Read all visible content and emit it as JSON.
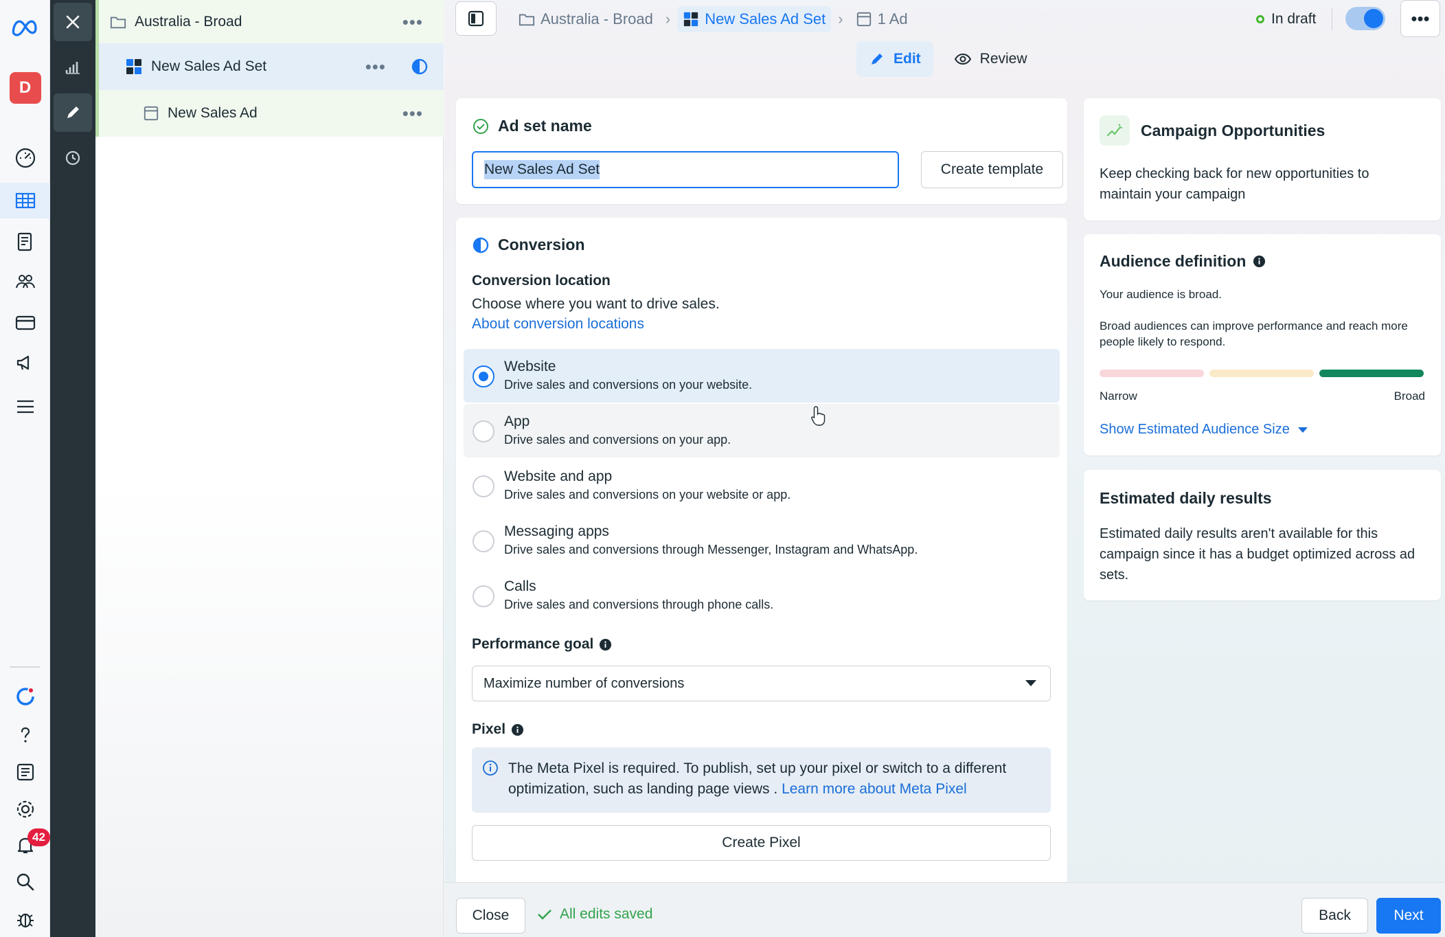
{
  "rail": {
    "avatar_letter": "D",
    "notification_count": "42"
  },
  "tree": {
    "campaign": "Australia - Broad",
    "adset": "New Sales Ad Set",
    "ad": "New Sales Ad",
    "more": "•••"
  },
  "breadcrumb": {
    "campaign": "Australia - Broad",
    "adset": "New Sales Ad Set",
    "ads": "1 Ad"
  },
  "status": {
    "label": "In draft",
    "toggle_on": true
  },
  "modes": {
    "edit": "Edit",
    "review": "Review"
  },
  "adset_name": {
    "title": "Ad set name",
    "value": "New Sales Ad Set",
    "template_button": "Create template"
  },
  "conversion": {
    "title": "Conversion",
    "location_heading": "Conversion location",
    "location_desc": "Choose where you want to drive sales.",
    "location_link": "About conversion locations",
    "options": [
      {
        "label": "Website",
        "desc": "Drive sales and conversions on your website.",
        "selected": true
      },
      {
        "label": "App",
        "desc": "Drive sales and conversions on your app.",
        "selected": false
      },
      {
        "label": "Website and app",
        "desc": "Drive sales and conversions on your website or app.",
        "selected": false
      },
      {
        "label": "Messaging apps",
        "desc": "Drive sales and conversions through Messenger, Instagram and WhatsApp.",
        "selected": false
      },
      {
        "label": "Calls",
        "desc": "Drive sales and conversions through phone calls.",
        "selected": false
      }
    ],
    "performance_goal_heading": "Performance goal",
    "performance_goal_value": "Maximize number of conversions",
    "pixel_heading": "Pixel",
    "pixel_notice": "The Meta Pixel is required. To publish, set up your pixel or switch to a different optimization, such as landing page views . ",
    "pixel_link": "Learn more about Meta Pixel",
    "pixel_button": "Create Pixel"
  },
  "opportunities": {
    "title": "Campaign Opportunities",
    "text": "Keep checking back for new opportunities to maintain your campaign"
  },
  "audience": {
    "title": "Audience definition",
    "summary": "Your audience is broad.",
    "detail": "Broad audiences can improve performance and reach more people likely to respond.",
    "narrow_label": "Narrow",
    "broad_label": "Broad",
    "show_size": "Show Estimated Audience Size"
  },
  "estimated": {
    "title": "Estimated daily results",
    "text": "Estimated daily results aren't available for this campaign since it has a budget optimized across ad sets."
  },
  "footer": {
    "close": "Close",
    "saved": "All edits saved",
    "back": "Back",
    "next": "Next"
  },
  "colors": {
    "accent": "#1877f2",
    "success": "#31a24c",
    "meter_narrow": "#f8d7da",
    "meter_mid": "#fbeac7",
    "meter_broad": "#12875b"
  }
}
